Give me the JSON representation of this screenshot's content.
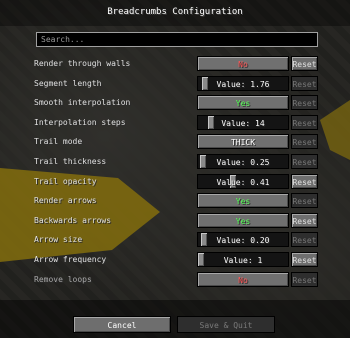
{
  "title": "Breadcrumbs Configuration",
  "search": {
    "placeholder": "Search..."
  },
  "colors": {
    "on": "#55ff55",
    "off": "#ff5555",
    "arrow": "#c9a815"
  },
  "rows": [
    {
      "label": "Render through walls",
      "type": "toggle",
      "value": "No",
      "reset": "Reset",
      "reset_enabled": true
    },
    {
      "label": "Segment length",
      "type": "slider",
      "value": "Value: 1.76",
      "level": 0.05,
      "reset": "Reset",
      "reset_enabled": false
    },
    {
      "label": "Smooth interpolation",
      "type": "toggle",
      "value": "Yes",
      "reset": "Reset",
      "reset_enabled": false
    },
    {
      "label": "Interpolation steps",
      "type": "slider",
      "value": "Value: 14",
      "level": 0.12,
      "reset": "Reset",
      "reset_enabled": false
    },
    {
      "label": "Trail mode",
      "type": "button",
      "value": "THICK",
      "reset": "Reset",
      "reset_enabled": false
    },
    {
      "label": "Trail thickness",
      "type": "slider",
      "value": "Value: 0.25",
      "level": 0.02,
      "reset": "Reset",
      "reset_enabled": false
    },
    {
      "label": "Trail opacity",
      "type": "slider",
      "value": "Value: 0.41",
      "level": 0.38,
      "reset": "Reset",
      "reset_enabled": true
    },
    {
      "label": "Render arrows",
      "type": "toggle",
      "value": "Yes",
      "reset": "Reset",
      "reset_enabled": false
    },
    {
      "label": "Backwards arrows",
      "type": "toggle",
      "value": "Yes",
      "reset": "Reset",
      "reset_enabled": true
    },
    {
      "label": "Arrow size",
      "type": "slider",
      "value": "Value: 0.20",
      "level": 0.04,
      "reset": "Reset",
      "reset_enabled": false
    },
    {
      "label": "Arrow frequency",
      "type": "slider",
      "value": "Value: 1",
      "level": 0.0,
      "reset": "Reset",
      "reset_enabled": true
    },
    {
      "label": "Remove loops",
      "type": "toggle",
      "value": "No",
      "reset": "Reset",
      "reset_enabled": false
    }
  ],
  "footer": {
    "cancel": "Cancel",
    "save": "Save & Quit"
  }
}
